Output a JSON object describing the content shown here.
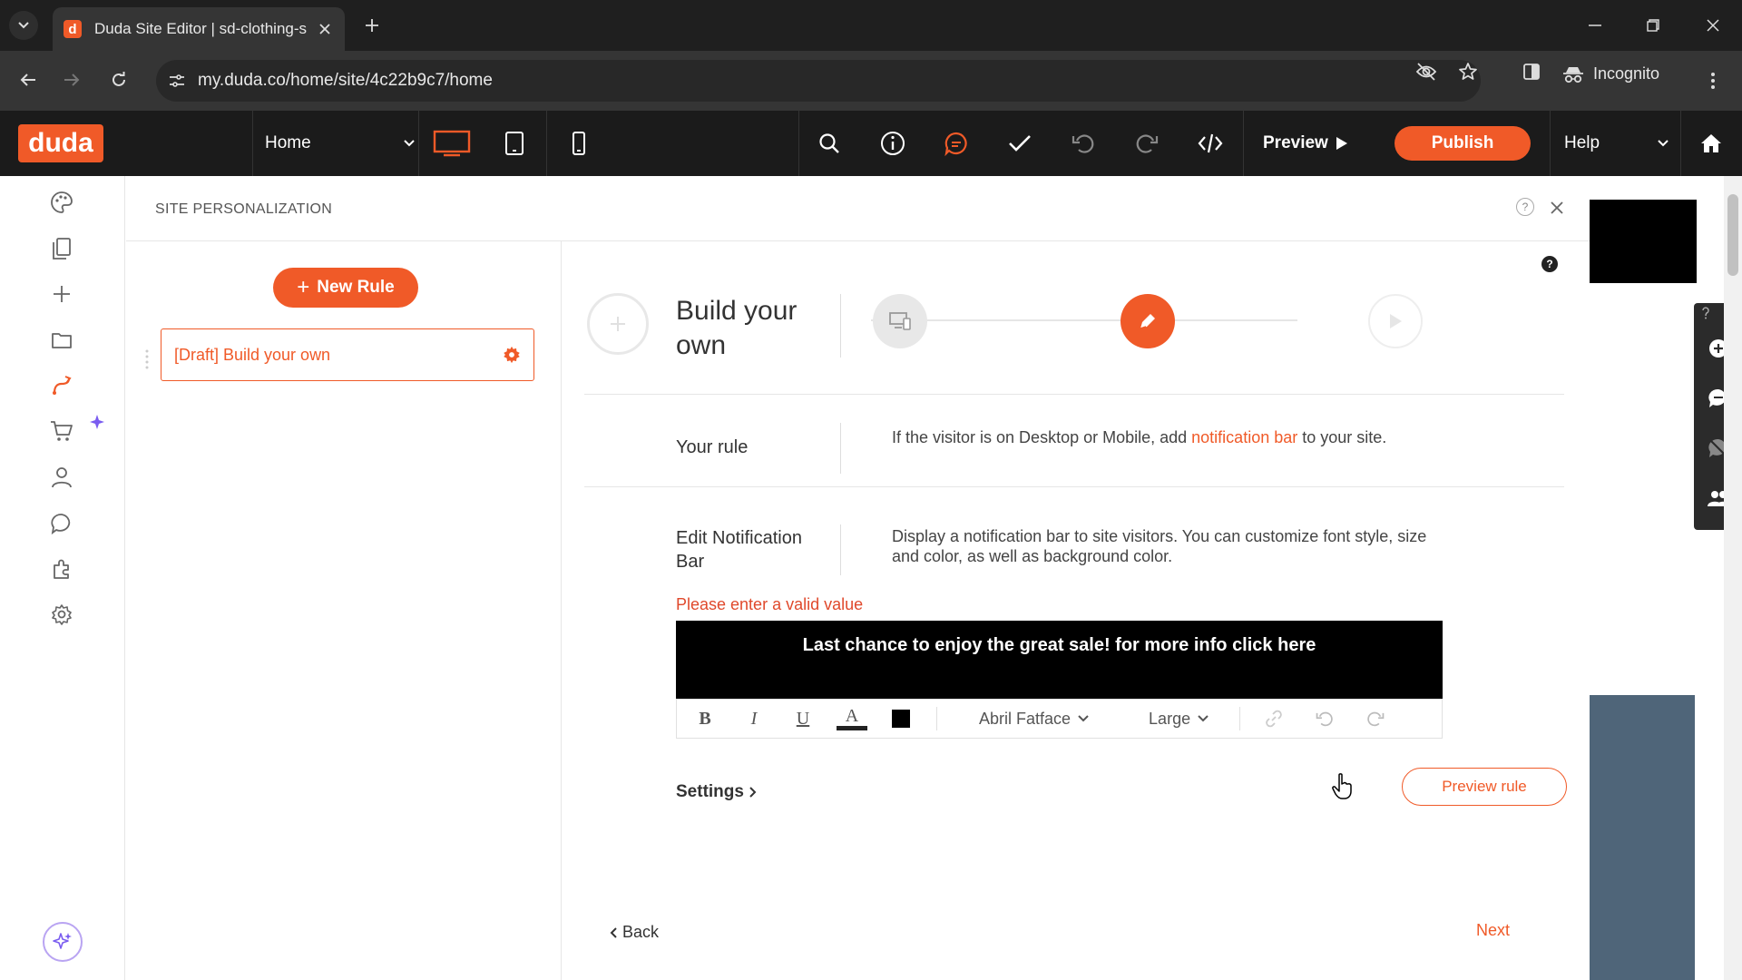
{
  "browser": {
    "tab_title": "Duda Site Editor | sd-clothing-s",
    "url": "my.duda.co/home/site/4c22b9c7/home",
    "incognito_label": "Incognito"
  },
  "toolbar": {
    "logo": "duda",
    "page_select": "Home",
    "preview_label": "Preview",
    "publish_label": "Publish",
    "help_label": "Help"
  },
  "panel": {
    "title": "SITE PERSONALIZATION",
    "help_glyph": "?",
    "new_rule_label": "New Rule",
    "rules": [
      {
        "label": "[Draft] Build your own"
      }
    ]
  },
  "detail": {
    "heading": "Build your own",
    "help_glyph": "?",
    "your_rule_label": "Your rule",
    "rule_text_before": "If the visitor is on Desktop or Mobile, add ",
    "rule_text_highlight": "notification bar",
    "rule_text_after": " to your site.",
    "edit_label": "Edit  Notification Bar",
    "edit_description": "Display a notification bar to site visitors. You can customize font style, size and color, as well as background color.",
    "error_message": "Please enter a valid value",
    "notification_text": "Last chance to enjoy the great sale! for more info click here",
    "font_family_value": "Abril Fatface",
    "font_size_value": "Large",
    "bold_glyph": "B",
    "italic_glyph": "I",
    "underline_glyph": "U",
    "text_color_glyph": "A",
    "settings_label": "Settings",
    "preview_rule_label": "Preview rule",
    "back_label": "Back",
    "next_label": "Next"
  },
  "colors": {
    "accent": "#f05a28",
    "toolbar_bg": "#1b1b1b",
    "chrome_bg": "#353535",
    "error": "#e0492c"
  },
  "icons": {
    "rail": [
      "palette-icon",
      "pages-icon",
      "add-icon",
      "folder-icon",
      "personalization-icon",
      "cart-icon",
      "user-icon",
      "chat-icon",
      "widget-icon",
      "settings-icon",
      "ai-sparkle-icon"
    ],
    "steps": [
      "device-trigger-icon",
      "action-icon",
      "play-icon"
    ]
  }
}
